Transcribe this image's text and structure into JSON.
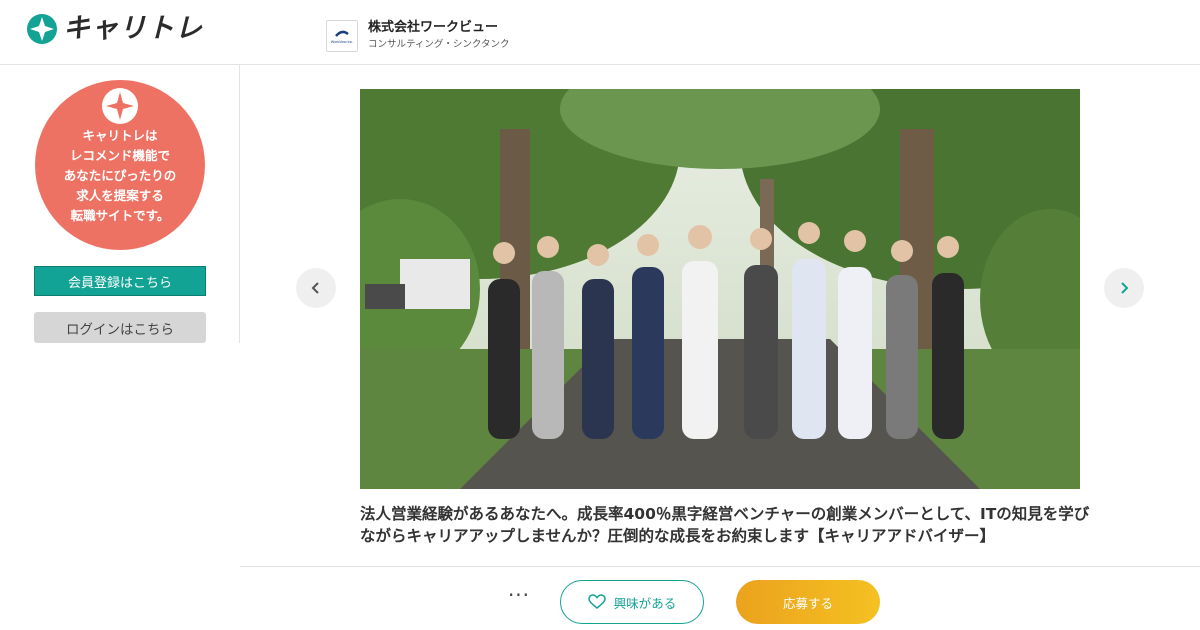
{
  "header": {
    "logo_text": "キャリトレ",
    "company_name": "株式会社ワークビュー",
    "company_type": "コンサルティング・シンクタンク",
    "company_logo_text": "WorkView Inc."
  },
  "sidebar": {
    "promo_lines": [
      "キャリトレは",
      "レコメンド機能で",
      "あなたにぴったりの",
      "求人を提案する",
      "転職サイトです。"
    ],
    "register_label": "会員登録はこちら",
    "login_label": "ログインはこちら"
  },
  "main": {
    "photo_icon": "team-photo",
    "prev_icon": "chevron-left-icon",
    "next_icon": "chevron-right-icon",
    "job_title": "法人営業経験があるあなたへ。成長率400％黒字経営ベンチャーの創業メンバーとして、ITの知見を学びながらキャリアアップしませんか？圧倒的な成長をお約束します【キャリアアドバイザー】"
  },
  "actions": {
    "more_label": "···",
    "interest_label": "興味がある",
    "apply_label": "応募する"
  },
  "colors": {
    "brand_teal": "#12a394",
    "promo_coral": "#ee7263",
    "apply_orange": "#f0b020"
  }
}
